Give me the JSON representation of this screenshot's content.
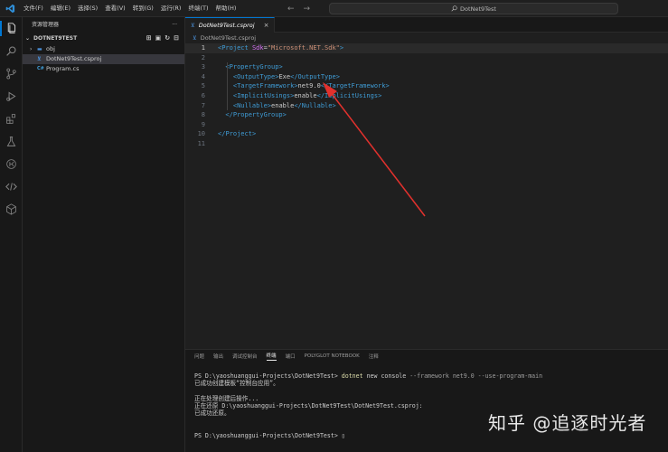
{
  "menu": [
    "文件(F)",
    "编辑(E)",
    "选择(S)",
    "查看(V)",
    "转到(G)",
    "运行(R)",
    "终端(T)",
    "帮助(H)"
  ],
  "nav": {
    "back": "←",
    "forward": "→"
  },
  "search": {
    "text": "DotNet9Test"
  },
  "sidebar": {
    "title": "资源管理器",
    "more": "···",
    "folder": "DOTNET9TEST",
    "items": [
      {
        "label": "obj",
        "kind": "folder"
      },
      {
        "label": "DotNet9Test.csproj",
        "kind": "csproj"
      },
      {
        "label": "Program.cs",
        "kind": "cs"
      }
    ]
  },
  "editor": {
    "tab_label": "DotNet9Test.csproj",
    "breadcrumb": "DotNet9Test.csproj",
    "close": "×"
  },
  "code": {
    "line_numbers": [
      "1",
      "2",
      "3",
      "4",
      "5",
      "6",
      "7",
      "8",
      "9",
      "10",
      "11"
    ],
    "lines": [
      [
        {
          "t": "<",
          "c": "c-tag"
        },
        {
          "t": "Project",
          "c": "c-tag"
        },
        {
          "t": " Sdk",
          "c": "c-name"
        },
        {
          "t": "=",
          "c": "c-txt"
        },
        {
          "t": "\"Microsoft.NET.Sdk\"",
          "c": "c-str"
        },
        {
          "t": ">",
          "c": "c-tag"
        }
      ],
      [],
      [
        {
          "t": "  <",
          "c": "c-tag"
        },
        {
          "t": "PropertyGroup",
          "c": "c-tag"
        },
        {
          "t": ">",
          "c": "c-tag"
        }
      ],
      [
        {
          "t": "    <",
          "c": "c-tag"
        },
        {
          "t": "OutputType",
          "c": "c-tag"
        },
        {
          "t": ">",
          "c": "c-tag"
        },
        {
          "t": "Exe",
          "c": "c-txt"
        },
        {
          "t": "</",
          "c": "c-tag"
        },
        {
          "t": "OutputType",
          "c": "c-tag"
        },
        {
          "t": ">",
          "c": "c-tag"
        }
      ],
      [
        {
          "t": "    <",
          "c": "c-tag"
        },
        {
          "t": "TargetFramework",
          "c": "c-tag"
        },
        {
          "t": ">",
          "c": "c-tag"
        },
        {
          "t": "net9.0",
          "c": "c-txt"
        },
        {
          "t": "</",
          "c": "c-tag"
        },
        {
          "t": "TargetFramework",
          "c": "c-tag"
        },
        {
          "t": ">",
          "c": "c-tag"
        }
      ],
      [
        {
          "t": "    <",
          "c": "c-tag"
        },
        {
          "t": "ImplicitUsings",
          "c": "c-tag"
        },
        {
          "t": ">",
          "c": "c-tag"
        },
        {
          "t": "enable",
          "c": "c-txt"
        },
        {
          "t": "</",
          "c": "c-tag"
        },
        {
          "t": "ImplicitUsings",
          "c": "c-tag"
        },
        {
          "t": ">",
          "c": "c-tag"
        }
      ],
      [
        {
          "t": "    <",
          "c": "c-tag"
        },
        {
          "t": "Nullable",
          "c": "c-tag"
        },
        {
          "t": ">",
          "c": "c-tag"
        },
        {
          "t": "enable",
          "c": "c-txt"
        },
        {
          "t": "</",
          "c": "c-tag"
        },
        {
          "t": "Nullable",
          "c": "c-tag"
        },
        {
          "t": ">",
          "c": "c-tag"
        }
      ],
      [
        {
          "t": "  </",
          "c": "c-tag"
        },
        {
          "t": "PropertyGroup",
          "c": "c-tag"
        },
        {
          "t": ">",
          "c": "c-tag"
        }
      ],
      [],
      [
        {
          "t": "</",
          "c": "c-tag"
        },
        {
          "t": "Project",
          "c": "c-tag"
        },
        {
          "t": ">",
          "c": "c-tag"
        }
      ],
      []
    ]
  },
  "panel": {
    "tabs": [
      "问题",
      "输出",
      "调试控制台",
      "终端",
      "端口",
      "POLYGLOT NOTEBOOK",
      "注释"
    ],
    "active_tab": 3
  },
  "terminal": {
    "prompt1": "PS D:\\yaoshuanggui-Projects\\DotNet9Test> ",
    "cmd_kw": "dotnet",
    "cmd_rest": " new console ",
    "cmd_args": "--framework net9.0 --use-program-main",
    "out1": "已成功创建模板“控制台应用”。",
    "out2": "正在处理创建后操作...",
    "out3": "正在还原 D:\\yaoshuanggui-Projects\\DotNet9Test\\DotNet9Test.csproj:",
    "out4": "已成功还原。",
    "prompt2": "PS D:\\yaoshuanggui-Projects\\DotNet9Test> ",
    "cursor": "▯"
  },
  "watermark": "知乎 @追逐时光者",
  "colors": {
    "accent": "#0078d4",
    "arrow": "#e2312d"
  }
}
